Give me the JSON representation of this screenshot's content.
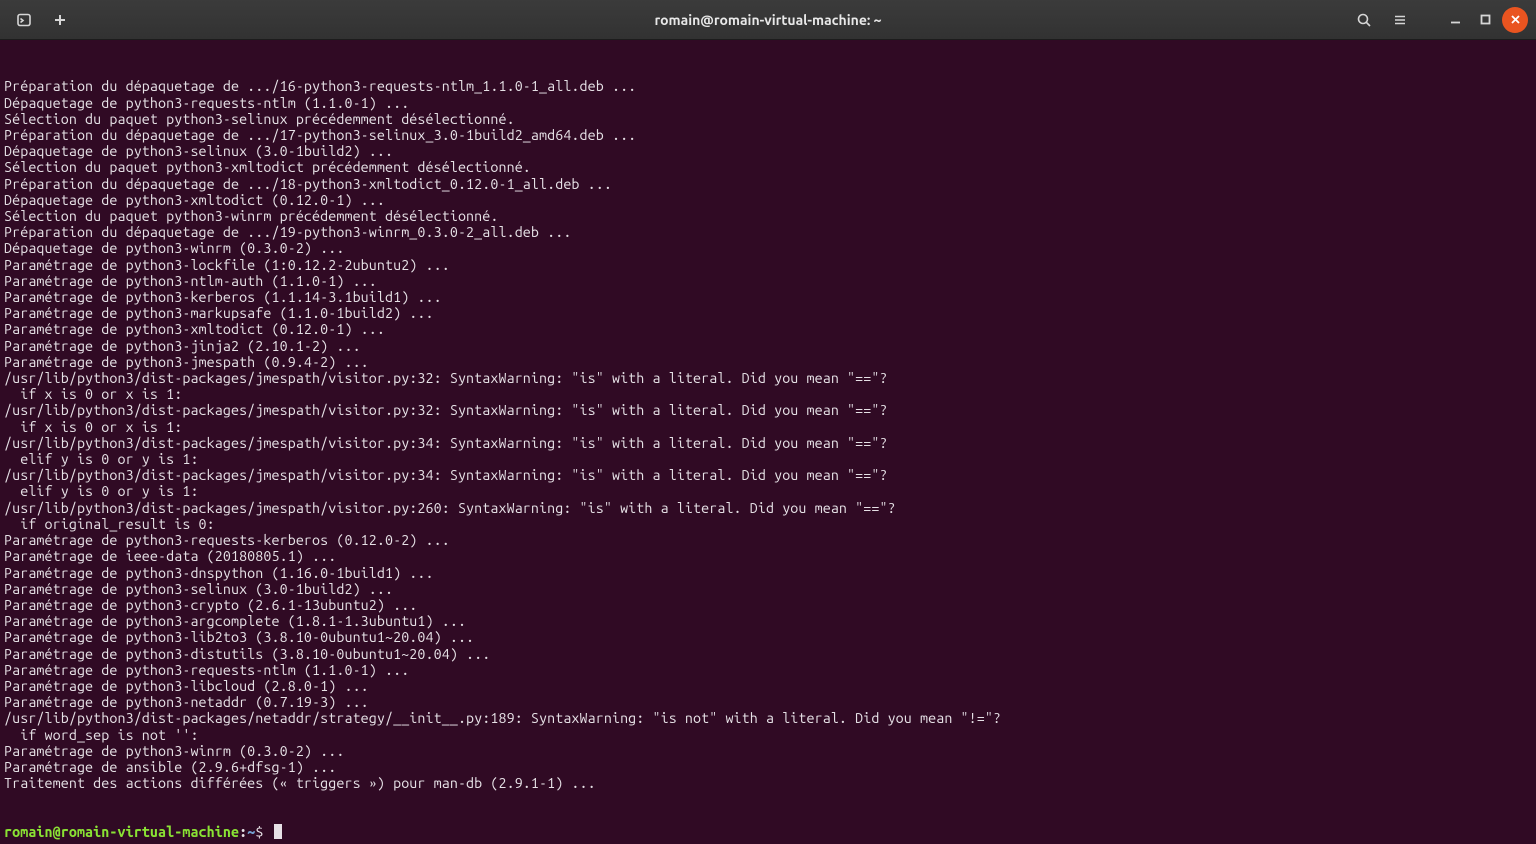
{
  "titlebar": {
    "title": "romain@romain-virtual-machine: ~"
  },
  "prompt": {
    "userhost": "romain@romain-virtual-machine",
    "path": "~",
    "symbol": "$"
  },
  "output": [
    "Préparation du dépaquetage de .../16-python3-requests-ntlm_1.1.0-1_all.deb ...",
    "Dépaquetage de python3-requests-ntlm (1.1.0-1) ...",
    "Sélection du paquet python3-selinux précédemment désélectionné.",
    "Préparation du dépaquetage de .../17-python3-selinux_3.0-1build2_amd64.deb ...",
    "Dépaquetage de python3-selinux (3.0-1build2) ...",
    "Sélection du paquet python3-xmltodict précédemment désélectionné.",
    "Préparation du dépaquetage de .../18-python3-xmltodict_0.12.0-1_all.deb ...",
    "Dépaquetage de python3-xmltodict (0.12.0-1) ...",
    "Sélection du paquet python3-winrm précédemment désélectionné.",
    "Préparation du dépaquetage de .../19-python3-winrm_0.3.0-2_all.deb ...",
    "Dépaquetage de python3-winrm (0.3.0-2) ...",
    "Paramétrage de python3-lockfile (1:0.12.2-2ubuntu2) ...",
    "Paramétrage de python3-ntlm-auth (1.1.0-1) ...",
    "Paramétrage de python3-kerberos (1.1.14-3.1build1) ...",
    "Paramétrage de python3-markupsafe (1.1.0-1build2) ...",
    "Paramétrage de python3-xmltodict (0.12.0-1) ...",
    "Paramétrage de python3-jinja2 (2.10.1-2) ...",
    "Paramétrage de python3-jmespath (0.9.4-2) ...",
    "/usr/lib/python3/dist-packages/jmespath/visitor.py:32: SyntaxWarning: \"is\" with a literal. Did you mean \"==\"?",
    "  if x is 0 or x is 1:",
    "/usr/lib/python3/dist-packages/jmespath/visitor.py:32: SyntaxWarning: \"is\" with a literal. Did you mean \"==\"?",
    "  if x is 0 or x is 1:",
    "/usr/lib/python3/dist-packages/jmespath/visitor.py:34: SyntaxWarning: \"is\" with a literal. Did you mean \"==\"?",
    "  elif y is 0 or y is 1:",
    "/usr/lib/python3/dist-packages/jmespath/visitor.py:34: SyntaxWarning: \"is\" with a literal. Did you mean \"==\"?",
    "  elif y is 0 or y is 1:",
    "/usr/lib/python3/dist-packages/jmespath/visitor.py:260: SyntaxWarning: \"is\" with a literal. Did you mean \"==\"?",
    "  if original_result is 0:",
    "Paramétrage de python3-requests-kerberos (0.12.0-2) ...",
    "Paramétrage de ieee-data (20180805.1) ...",
    "Paramétrage de python3-dnspython (1.16.0-1build1) ...",
    "Paramétrage de python3-selinux (3.0-1build2) ...",
    "Paramétrage de python3-crypto (2.6.1-13ubuntu2) ...",
    "Paramétrage de python3-argcomplete (1.8.1-1.3ubuntu1) ...",
    "Paramétrage de python3-lib2to3 (3.8.10-0ubuntu1~20.04) ...",
    "Paramétrage de python3-distutils (3.8.10-0ubuntu1~20.04) ...",
    "Paramétrage de python3-requests-ntlm (1.1.0-1) ...",
    "Paramétrage de python3-libcloud (2.8.0-1) ...",
    "Paramétrage de python3-netaddr (0.7.19-3) ...",
    "/usr/lib/python3/dist-packages/netaddr/strategy/__init__.py:189: SyntaxWarning: \"is not\" with a literal. Did you mean \"!=\"?",
    "  if word_sep is not '':",
    "Paramétrage de python3-winrm (0.3.0-2) ...",
    "Paramétrage de ansible (2.9.6+dfsg-1) ...",
    "Traitement des actions différées (« triggers ») pour man-db (2.9.1-1) ..."
  ]
}
